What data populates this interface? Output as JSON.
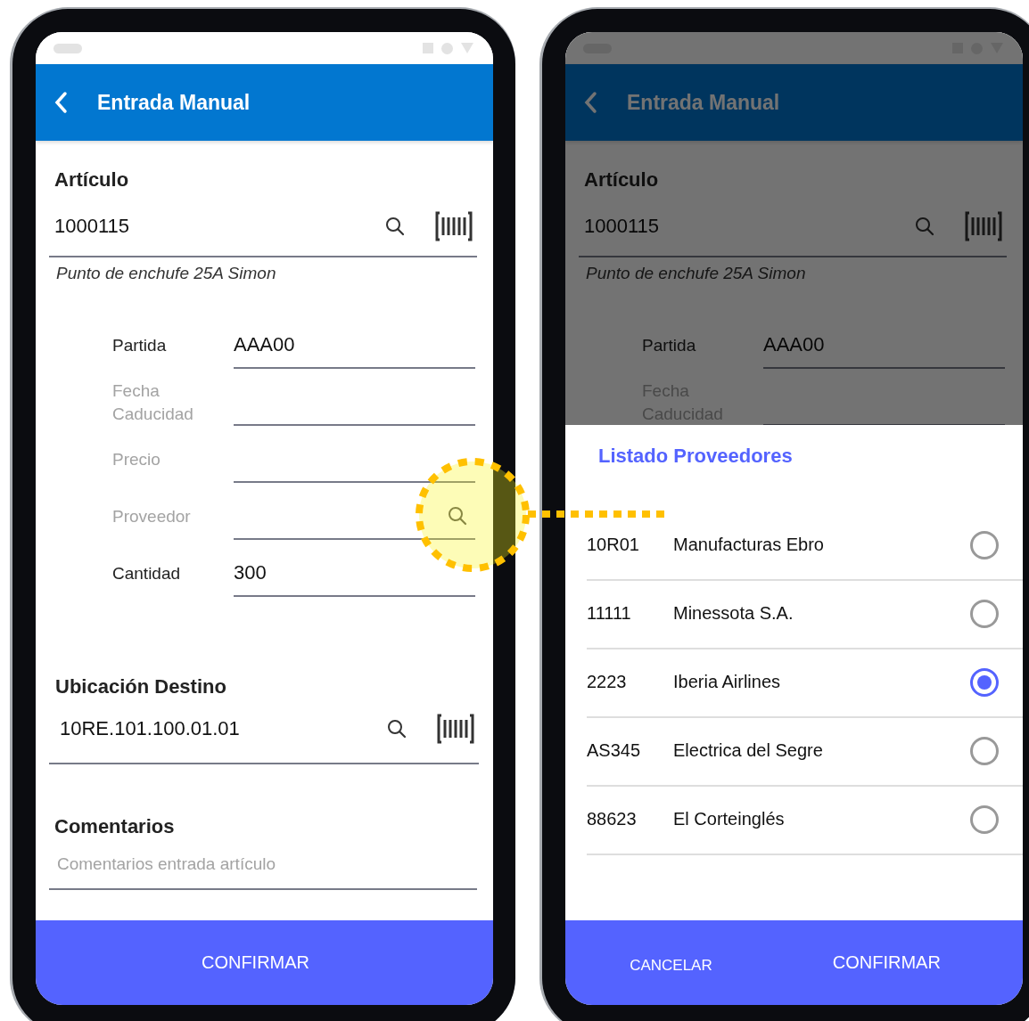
{
  "screens": [
    {
      "kind": "form",
      "dimmed": false,
      "title": "Entrada Manual",
      "article": {
        "label": "Artículo",
        "value": "1000115",
        "description": "Punto de enchufe 25A Simon"
      },
      "fields": [
        {
          "label": "Partida",
          "value": "AAA00",
          "kind": "text"
        },
        {
          "label": "Fecha Caducidad",
          "kind": "text"
        },
        {
          "label": "Precio",
          "kind": "text"
        },
        {
          "label": "Proveedor",
          "kind": "lookup"
        },
        {
          "label": "Cantidad",
          "value": "300",
          "kind": "text"
        }
      ],
      "destination": {
        "label": "Ubicación Destino",
        "value": "10RE.101.100.01.01"
      },
      "comments": {
        "label": "Comentarios",
        "placeholder": "Comentarios entrada artículo"
      },
      "buttons": [
        {
          "label": "CONFIRMAR",
          "kind": "primary"
        }
      ]
    },
    {
      "kind": "picker",
      "dimmed": true,
      "title": "Entrada Manual",
      "article": {
        "label": "Artículo",
        "value": "1000115",
        "description": "Punto de enchufe 25A Simon"
      },
      "fields": [
        {
          "label": "Partida",
          "value": "AAA00",
          "kind": "text"
        },
        {
          "label": "Fecha Caducidad",
          "kind": "text"
        }
      ],
      "dialog": {
        "title": "Listado Proveedores",
        "items": [
          {
            "code": "10R01",
            "name": "Manufacturas Ebro",
            "selected": false
          },
          {
            "code": "11111",
            "name": "Minessota S.A.",
            "selected": false
          },
          {
            "code": "2223",
            "name": "Iberia Airlines",
            "selected": true
          },
          {
            "code": "AS345",
            "name": "Electrica del Segre",
            "selected": false
          },
          {
            "code": "88623",
            "name": "El Corteinglés",
            "selected": false
          }
        ]
      },
      "buttons": [
        {
          "label": "CANCELAR",
          "kind": "secondary"
        },
        {
          "label": "CONFIRMAR",
          "kind": "primary"
        }
      ]
    }
  ]
}
